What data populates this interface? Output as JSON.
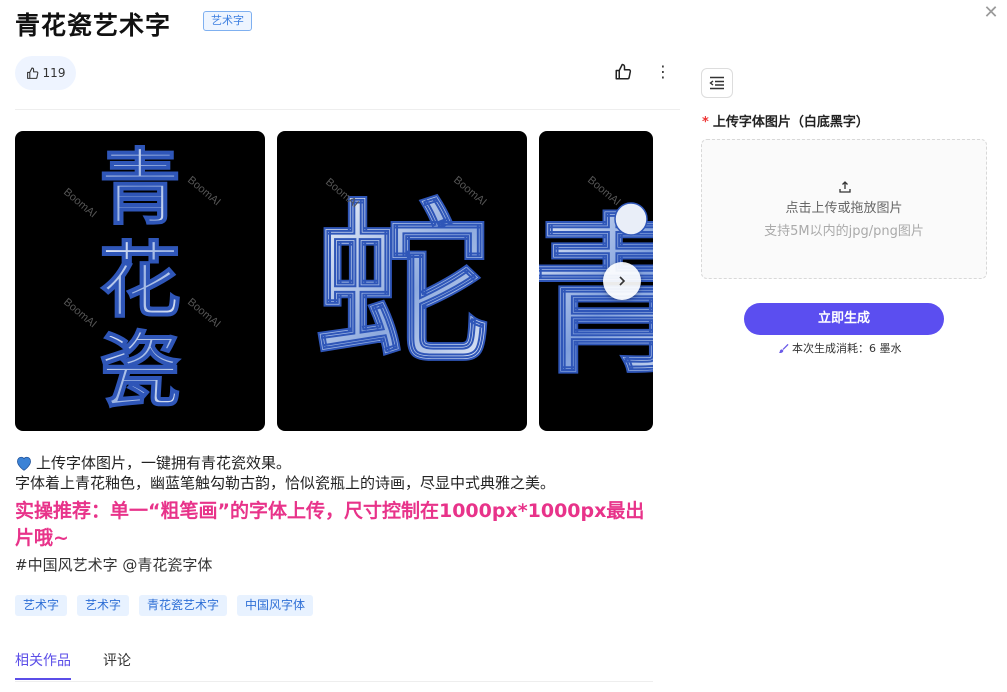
{
  "header": {
    "title": "青花瓷艺术字",
    "tag": "艺术字"
  },
  "actions": {
    "like_count": "119"
  },
  "carousel": {
    "watermark": "BoomAI",
    "images": [
      {
        "chars": [
          "青",
          "花",
          "瓷"
        ]
      },
      {
        "chars": [
          "蛇"
        ]
      },
      {
        "chars": [
          "青"
        ]
      }
    ]
  },
  "description": {
    "line1": "上传字体图片，一键拥有青花瓷效果。",
    "line2": "字体着上青花釉色，幽蓝笔触勾勒古韵，恰似瓷瓶上的诗画，尽显中式典雅之美。",
    "highlight": "实操推荐：单一“粗笔画”的字体上传，尺寸控制在1000px*1000px最出片哦~",
    "hashtags": "#中国风艺术字 @青花瓷字体"
  },
  "tags": [
    "艺术字",
    "艺术字",
    "青花瓷艺术字",
    "中国风字体"
  ],
  "tabs": [
    {
      "label": "相关作品",
      "active": true
    },
    {
      "label": "评论",
      "active": false
    }
  ],
  "panel": {
    "upload_label": "上传字体图片（白底黑字）",
    "required_mark": "*",
    "dropzone_main": "点击上传或拖放图片",
    "dropzone_sub": "支持5M以内的jpg/png图片",
    "generate_button": "立即生成",
    "cost_text": "本次生成消耗：6 墨水"
  },
  "colors": {
    "accent": "#5b4ef0",
    "highlight": "#e8338a",
    "tag_text": "#2e6fd6",
    "porcelain_blue": "#2f56b8"
  }
}
